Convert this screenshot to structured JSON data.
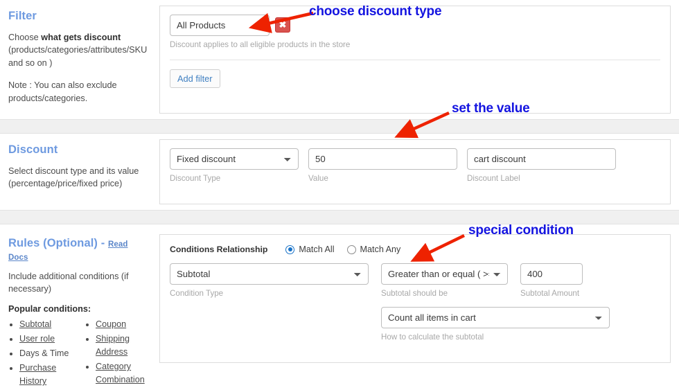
{
  "filter_section": {
    "heading": "Filter",
    "desc_lead": "Choose ",
    "desc_bold": "what gets discount",
    "desc_tail": " (products/categories/attributes/SKU and so on )",
    "note": "Note : You can also exclude products/categories.",
    "product_select_value": "All Products",
    "product_select_options": [
      "All Products"
    ],
    "remove_button_label": "✖",
    "product_hint": "Discount applies to all eligible products in the store",
    "add_filter_label": "Add filter"
  },
  "discount_section": {
    "heading": "Discount",
    "desc": "Select discount type and its value (percentage/price/fixed price)",
    "type_value": "Fixed discount",
    "type_options": [
      "Fixed discount"
    ],
    "type_hint": "Discount Type",
    "value_value": "50",
    "value_hint": "Value",
    "label_value": "cart discount",
    "label_hint": "Discount Label"
  },
  "rules_section": {
    "heading": "Rules (Optional)",
    "heading_dash": " - ",
    "read_docs": "Read Docs",
    "desc": "Include additional conditions (if necessary)",
    "popular_title": "Popular conditions:",
    "conditions_col1": [
      "Subtotal",
      "User role",
      "Days & Time",
      "Purchase History"
    ],
    "conditions_col2": [
      "Coupon",
      "Shipping Address",
      "Category Combination"
    ],
    "relationship_label": "Conditions Relationship",
    "match_all_label": "Match All",
    "match_any_label": "Match Any",
    "match_all_selected": true,
    "condition_type_value": "Subtotal",
    "condition_type_options": [
      "Subtotal"
    ],
    "condition_type_hint": "Condition Type",
    "operator_value": "Greater than or equal ( >= )",
    "operator_options": [
      "Greater than or equal ( >= )"
    ],
    "operator_hint": "Subtotal should be",
    "amount_value": "400",
    "amount_hint": "Subtotal Amount",
    "calc_value": "Count all items in cart",
    "calc_options": [
      "Count all items in cart"
    ],
    "calc_hint": "How to calculate the subtotal"
  },
  "annotations": {
    "choose_discount_type": "choose discount type",
    "set_the_value": "set the value",
    "special_condition": "special condition",
    "color": "#1414e0",
    "arrow_color": "#ee2200"
  }
}
